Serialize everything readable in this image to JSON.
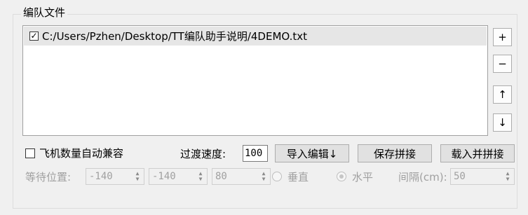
{
  "group": {
    "title": "编队文件"
  },
  "file_list": {
    "items": [
      {
        "checked": true,
        "label": "C:/Users/Pzhen/Desktop/TT编队助手说明/4DEMO.txt"
      }
    ]
  },
  "side_buttons": {
    "add": "+",
    "remove": "−",
    "up": "↑",
    "down": "↓"
  },
  "options": {
    "auto_compat_label": "飞机数量自动兼容",
    "auto_compat_checked": false,
    "transition_speed_label": "过渡速度:",
    "transition_speed_value": "100",
    "import_edit_label": "导入编辑↓",
    "save_splice_label": "保存拼接",
    "load_splice_label": "载入并拼接"
  },
  "wait_position": {
    "label": "等待位置:",
    "x": "-140",
    "y": "-140",
    "z": "80",
    "vertical_label": "垂直",
    "horizontal_label": "水平",
    "selected": "horizontal",
    "interval_label": "间隔(cm):",
    "interval_value": "50"
  }
}
